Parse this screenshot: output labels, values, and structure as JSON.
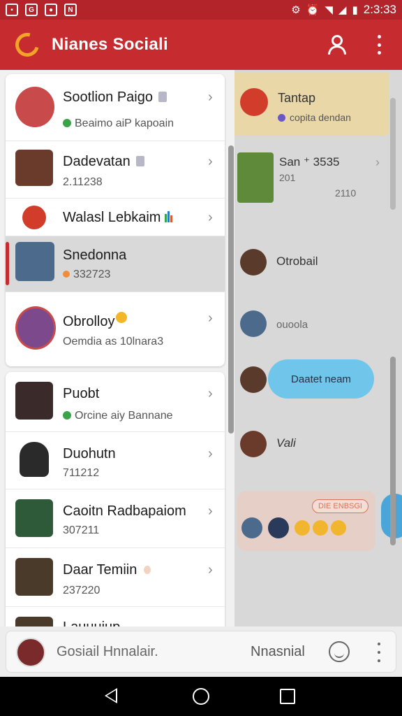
{
  "status_bar": {
    "time": "2:3:33",
    "icons": [
      "notification-icon",
      "chrome-icon",
      "app-icon",
      "n-icon",
      "gear-icon",
      "alarm-icon",
      "wifi-icon",
      "signal-icon",
      "battery-icon"
    ]
  },
  "app_bar": {
    "title": "Nianes Sociali",
    "accent": "#c62b30",
    "icons": [
      "logo-icon",
      "user-icon",
      "more-vert-icon"
    ]
  },
  "drawer": {
    "group1": [
      {
        "name": "Sootlion Paigo",
        "sub": "Beaimo aiP kapoain",
        "status": "green",
        "avatar_color": "#c84a4a"
      },
      {
        "name": "Dadevatan",
        "sub": "2.11238",
        "status": "none",
        "avatar_color": "#6a3a2a"
      },
      {
        "name": "Walasl Lebkaim",
        "sub": "",
        "status": "none",
        "avatar_color": "#d23c2a"
      },
      {
        "name": "Snedonna",
        "sub": "332723",
        "status": "orange",
        "avatar_color": "#4b6a8c",
        "selected": true
      },
      {
        "name": "Obrolloy",
        "sub": "Oemdia as 10lnara3",
        "status": "none",
        "avatar_color": "#7c4a8c"
      }
    ],
    "group2": [
      {
        "name": "Puobt",
        "sub": "Orcine aiy Bannane",
        "status": "green",
        "avatar_color": "#3a2a2a"
      },
      {
        "name": "Duohutn",
        "sub": "711212",
        "status": "none",
        "avatar_color": "#2a2a2a"
      },
      {
        "name": "Caoitn Radbapaiom",
        "sub": "307211",
        "status": "none",
        "avatar_color": "#2f5a3a"
      },
      {
        "name": "Daar Temiin",
        "sub": "237220",
        "status": "none",
        "avatar_color": "#4a3a2a"
      },
      {
        "name": "Lauuuiup",
        "sub": "",
        "status": "none",
        "avatar_color": "#4a3a2a"
      }
    ]
  },
  "chat_panel": {
    "top": {
      "name": "Tantap",
      "sub": "copita dendan"
    },
    "rows": [
      {
        "name": "San ⁺ 3535",
        "sub": "201",
        "meta": "2110"
      },
      {
        "name": "Otrobail"
      },
      {
        "name": "ouoola"
      }
    ],
    "bubble": "Daatet neam",
    "last": "Vali",
    "card_tag": "DIE ENBSGI"
  },
  "bottom_bar": {
    "placeholder": "Gosiail Hnnalair.",
    "label": "Nnasnial"
  }
}
